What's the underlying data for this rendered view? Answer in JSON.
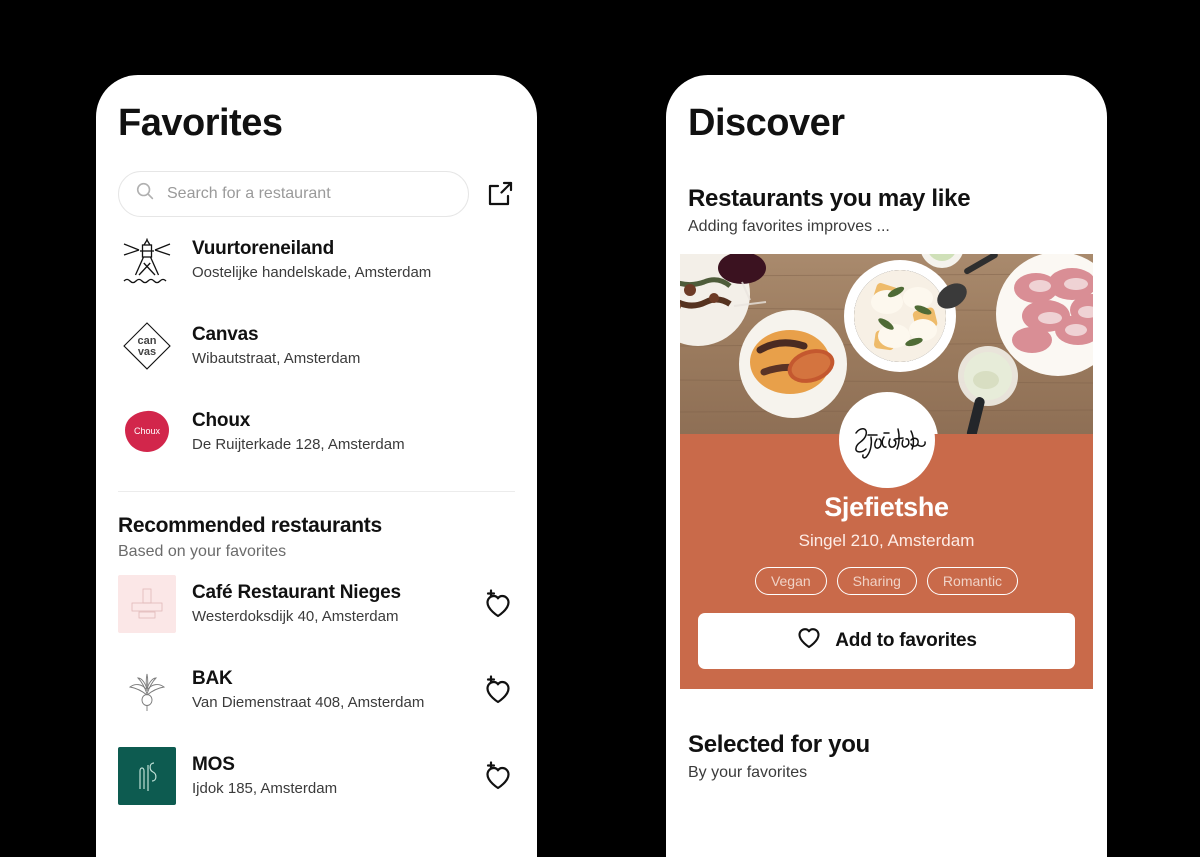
{
  "theme": {
    "accent": "#C96A4A",
    "background": "#000000",
    "panel": "#FFFFFF",
    "text_primary": "#111111",
    "text_secondary": "#6B6B6B"
  },
  "favorites_screen": {
    "title": "Favorites",
    "search": {
      "placeholder": "Search for a restaurant",
      "value": "",
      "icon": "search-icon"
    },
    "share_icon": "external-link-icon",
    "favorites": [
      {
        "name": "Vuurtoreneiland",
        "address": "Oostelijke handelskade, Amsterdam",
        "logo": "lighthouse-line-logo"
      },
      {
        "name": "Canvas",
        "address": "Wibautstraat, Amsterdam",
        "logo": "canvas-diamond-logo"
      },
      {
        "name": "Choux",
        "address": "De Ruijterkade 128, Amsterdam",
        "logo": "choux-red-blob-logo"
      }
    ],
    "recommended": {
      "title": "Recommended restaurants",
      "subtitle": "Based on your favorites",
      "items": [
        {
          "name": "Café Restaurant Nieges",
          "address": "Westerdoksdijk 40, Amsterdam",
          "logo": "nieges-pink-card-logo",
          "action_icon": "heart-plus-icon"
        },
        {
          "name": "BAK",
          "address": "Van Diemenstraat 408, Amsterdam",
          "logo": "bak-beet-sketch-logo",
          "action_icon": "heart-plus-icon"
        },
        {
          "name": "MOS",
          "address": "Ijdok 185, Amsterdam",
          "logo": "mos-green-logo",
          "action_icon": "heart-plus-icon"
        }
      ]
    }
  },
  "discover_screen": {
    "title": "Discover",
    "may_like": {
      "title": "Restaurants you may like",
      "subtitle": "Adding favorites improves ..."
    },
    "featured": {
      "photo_alt": "overhead-food-table-photo",
      "logo": "sjefietshe-script-logo",
      "name": "Sjefietshe",
      "address": "Singel 210, Amsterdam",
      "tags": [
        "Vegan",
        "Sharing",
        "Romantic"
      ],
      "add_button": {
        "label": "Add to favorites",
        "icon": "heart-outline-icon"
      }
    },
    "selected": {
      "title": "Selected for you",
      "subtitle": "By your favorites"
    }
  }
}
